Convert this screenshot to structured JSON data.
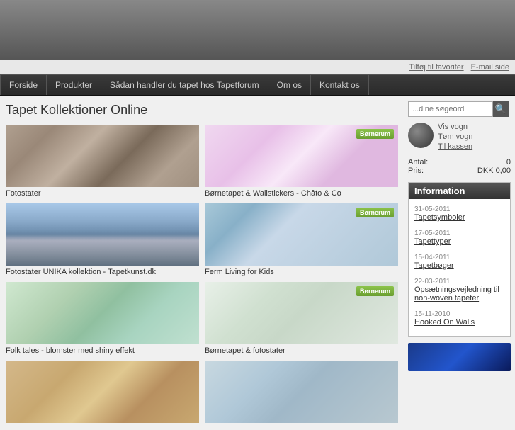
{
  "header": {
    "height": 85
  },
  "toplinks": {
    "favorites": "Tilføj til favoriter",
    "email": "E-mail side"
  },
  "nav": {
    "items": [
      {
        "label": "Forside"
      },
      {
        "label": "Produkter"
      },
      {
        "label": "Sådan handler du tapet hos Tapetforum"
      },
      {
        "label": "Om os"
      },
      {
        "label": "Kontakt os"
      }
    ]
  },
  "page": {
    "title": "Tapet Kollektioner Online"
  },
  "search": {
    "placeholder": "...dine søgeord"
  },
  "cart": {
    "view_label": "Vis vogn",
    "empty_label": "Tøm vogn",
    "checkout_label": "Til kassen",
    "antal_label": "Antal:",
    "antal_value": "0",
    "pris_label": "Pris:",
    "pris_value": "DKK 0,00"
  },
  "grid": {
    "items": [
      {
        "label": "Fotostater",
        "thumb": "stone",
        "col": 0
      },
      {
        "label": "Børnetapet & Wallstickers - Châto & Co",
        "thumb": "kids1",
        "col": 1
      },
      {
        "label": "Fotostater UNIKA kollektion - Tapetkunst.dk",
        "thumb": "newyork",
        "col": 0
      },
      {
        "label": "Ferm Living for Kids",
        "thumb": "ferm",
        "col": 1
      },
      {
        "label": "Folk tales - blomster med shiny effekt",
        "thumb": "folktales",
        "col": 0
      },
      {
        "label": "Børnetapet & fotostater",
        "thumb": "bornetapet",
        "col": 1
      },
      {
        "label": "",
        "thumb": "last1",
        "col": 0
      },
      {
        "label": "",
        "thumb": "last2",
        "col": 1
      }
    ]
  },
  "info": {
    "header": "Information",
    "entries": [
      {
        "date": "31-05-2011",
        "link": "Tapetsymboler"
      },
      {
        "date": "17-05-2011",
        "link": "Tapettyper"
      },
      {
        "date": "15-04-2011",
        "link": "Tapetbøger"
      },
      {
        "date": "22-03-2011",
        "link": "Opsætningsvejledning til non-woven tapeter"
      },
      {
        "date": "15-11-2010",
        "link": "Hooked On Walls"
      }
    ]
  }
}
